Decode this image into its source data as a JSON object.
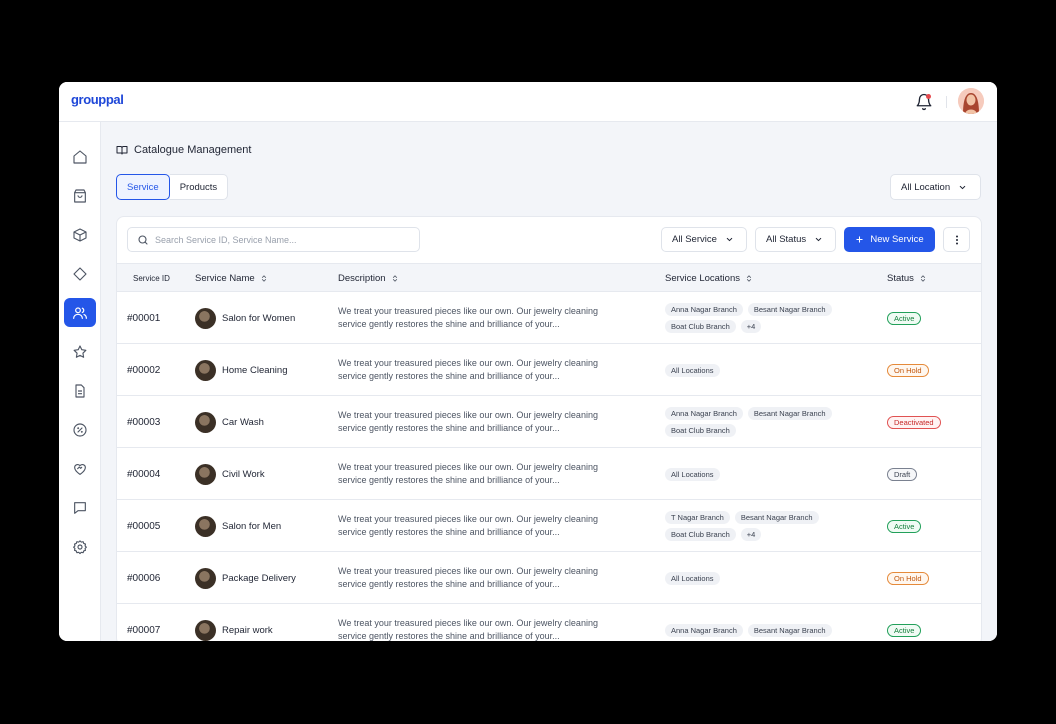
{
  "app": {
    "logo": "grouppal"
  },
  "header": {
    "notifications_icon": "bell-icon",
    "avatar_icon": "user-avatar"
  },
  "sidebar": {
    "items": [
      {
        "icon": "home-icon",
        "active": false
      },
      {
        "icon": "shopping-bag-icon",
        "active": false
      },
      {
        "icon": "box-icon",
        "active": false
      },
      {
        "icon": "tag-icon",
        "active": false
      },
      {
        "icon": "users-icon",
        "active": true
      },
      {
        "icon": "star-icon",
        "active": false
      },
      {
        "icon": "document-icon",
        "active": false
      },
      {
        "icon": "discount-icon",
        "active": false
      },
      {
        "icon": "heart-handshake-icon",
        "active": false
      },
      {
        "icon": "message-icon",
        "active": false
      },
      {
        "icon": "settings-icon",
        "active": false
      }
    ]
  },
  "page": {
    "title": "Catalogue Management",
    "tabs": [
      {
        "label": "Service",
        "active": true
      },
      {
        "label": "Products",
        "active": false
      }
    ],
    "location_filter": "All Location"
  },
  "toolbar": {
    "search_placeholder": "Search Service ID, Service Name...",
    "service_filter": "All Service",
    "status_filter": "All Status",
    "new_button": "New Service"
  },
  "table": {
    "headers": {
      "id": "Service ID",
      "name": "Service Name",
      "description": "Description",
      "locations": "Service Locations",
      "status": "Status"
    },
    "rows": [
      {
        "id": "#00001",
        "name": "Salon for Women",
        "description": "We treat your treasured pieces like our own. Our jewelry cleaning service gently restores the shine and brilliance of your...",
        "locations": [
          "Anna Nagar Branch",
          "Besant Nagar Branch",
          "Boat Club Branch",
          "+4"
        ],
        "status": "Active",
        "status_type": "active"
      },
      {
        "id": "#00002",
        "name": "Home Cleaning",
        "description": "We treat your treasured pieces like our own. Our jewelry cleaning service gently restores the shine and brilliance of your...",
        "locations": [
          "All Locations"
        ],
        "status": "On Hold",
        "status_type": "hold"
      },
      {
        "id": "#00003",
        "name": "Car Wash",
        "description": "We treat your treasured pieces like our own. Our jewelry cleaning service gently restores the shine and brilliance of your...",
        "locations": [
          "Anna Nagar Branch",
          "Besant Nagar Branch",
          "Boat Club Branch"
        ],
        "status": "Deactivated",
        "status_type": "deact"
      },
      {
        "id": "#00004",
        "name": "Civil Work",
        "description": "We treat your treasured pieces like our own. Our jewelry cleaning service gently restores the shine and brilliance of your...",
        "locations": [
          "All Locations"
        ],
        "status": "Draft",
        "status_type": "draft"
      },
      {
        "id": "#00005",
        "name": "Salon for Men",
        "description": "We treat your treasured pieces like our own. Our jewelry cleaning service gently restores the shine and brilliance of your...",
        "locations": [
          "T Nagar Branch",
          "Besant Nagar Branch",
          "Boat Club Branch",
          "+4"
        ],
        "status": "Active",
        "status_type": "active"
      },
      {
        "id": "#00006",
        "name": "Package Delivery",
        "description": "We treat your treasured pieces like our own. Our jewelry cleaning service gently restores the shine and brilliance of your...",
        "locations": [
          "All Locations"
        ],
        "status": "On Hold",
        "status_type": "hold"
      },
      {
        "id": "#00007",
        "name": "Repair work",
        "description": "We treat your treasured pieces like our own. Our jewelry cleaning service gently restores the shine and brilliance of your...",
        "locations": [
          "Anna Nagar Branch",
          "Besant Nagar Branch"
        ],
        "status": "Active",
        "status_type": "active"
      }
    ]
  },
  "colors": {
    "accent": "#2456e8",
    "logo": "#1e47d8",
    "active": "#15803d",
    "hold": "#c2570c",
    "deactivated": "#c62828",
    "draft": "#3b4250"
  }
}
